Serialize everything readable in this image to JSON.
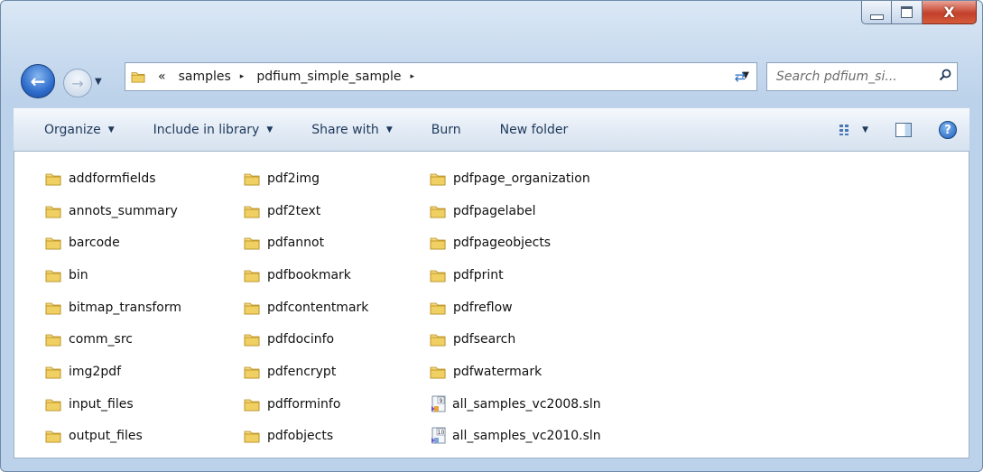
{
  "window": {
    "close_glyph": "X"
  },
  "address": {
    "overflow": "«",
    "crumbs": [
      "samples",
      "pdfium_simple_sample"
    ],
    "separator": "▸"
  },
  "search": {
    "placeholder": "Search pdfium_si..."
  },
  "toolbar": {
    "organize": "Organize",
    "include_in_library": "Include in library",
    "share_with": "Share with",
    "burn": "Burn",
    "new_folder": "New folder"
  },
  "files": {
    "col1": [
      "addformfields",
      "annots_summary",
      "barcode",
      "bin",
      "bitmap_transform",
      "comm_src",
      "img2pdf",
      "input_files",
      "output_files"
    ],
    "col2": [
      "pdf2img",
      "pdf2text",
      "pdfannot",
      "pdfbookmark",
      "pdfcontentmark",
      "pdfdocinfo",
      "pdfencrypt",
      "pdfforminfo",
      "pdfobjects"
    ],
    "col3": [
      "pdfpage_organization",
      "pdfpagelabel",
      "pdfpageobjects",
      "pdfprint",
      "pdfreflow",
      "pdfsearch",
      "pdfwatermark"
    ],
    "solutions": [
      "all_samples_vc2008.sln",
      "all_samples_vc2010.sln"
    ],
    "solution_badges": [
      "9",
      "10"
    ]
  },
  "colors": {
    "folder": "#e8c04a",
    "accent": "#2e6ccc",
    "close": "#c3402a"
  },
  "icons": [
    "back-arrow-icon",
    "forward-arrow-icon",
    "folder-icon",
    "refresh-icon",
    "search-icon",
    "views-icon",
    "preview-pane-icon",
    "help-icon",
    "solution-file-icon"
  ]
}
